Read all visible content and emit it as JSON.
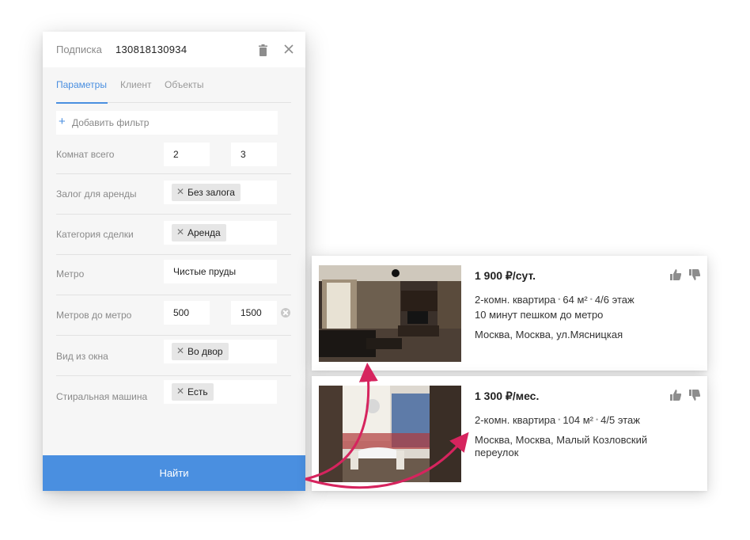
{
  "subscription": {
    "label": "Подписка",
    "id": "130818130934",
    "icons": {
      "delete": "trash-icon",
      "close": "close-icon"
    }
  },
  "tabs": [
    {
      "label": "Параметры",
      "active": true
    },
    {
      "label": "Клиент",
      "active": false
    },
    {
      "label": "Объекты",
      "active": false
    }
  ],
  "add_filter": {
    "icon": "plus-icon",
    "label": "Добавить фильтр"
  },
  "filters": {
    "rooms": {
      "label": "Комнат всего",
      "from": "2",
      "to": "3"
    },
    "deposit": {
      "label": "Залог для аренды",
      "chip": "Без залога"
    },
    "deal_category": {
      "label": "Категория сделки",
      "chip": "Аренда"
    },
    "metro": {
      "label": "Метро",
      "value": "Чистые пруды"
    },
    "meters_to_metro": {
      "label": "Метров до метро",
      "from": "500",
      "to": "1500"
    },
    "window_view": {
      "label": "Вид из окна",
      "chip": "Во двор"
    },
    "washing_machine": {
      "label": "Стиральная машина",
      "chip": "Есть"
    }
  },
  "search_button": {
    "label": "Найти",
    "color": "#4a8fe0"
  },
  "listings": [
    {
      "price": "1 900 ₽/сут.",
      "rooms": "2-комн. квартира",
      "area": "64 м²",
      "floor": "4/6 этаж",
      "walk": "10 минут пешком до метро",
      "address": "Москва, Москва, ул.Мясницкая"
    },
    {
      "price": "1 300 ₽/мес.",
      "rooms": "2-комн. квартира",
      "area": "104 м²",
      "floor": "4/5 этаж",
      "address": "Москва, Москва, Малый Козловский переулок"
    }
  ],
  "colors": {
    "accent": "#4a8fe0",
    "arrow": "#d6245e"
  }
}
